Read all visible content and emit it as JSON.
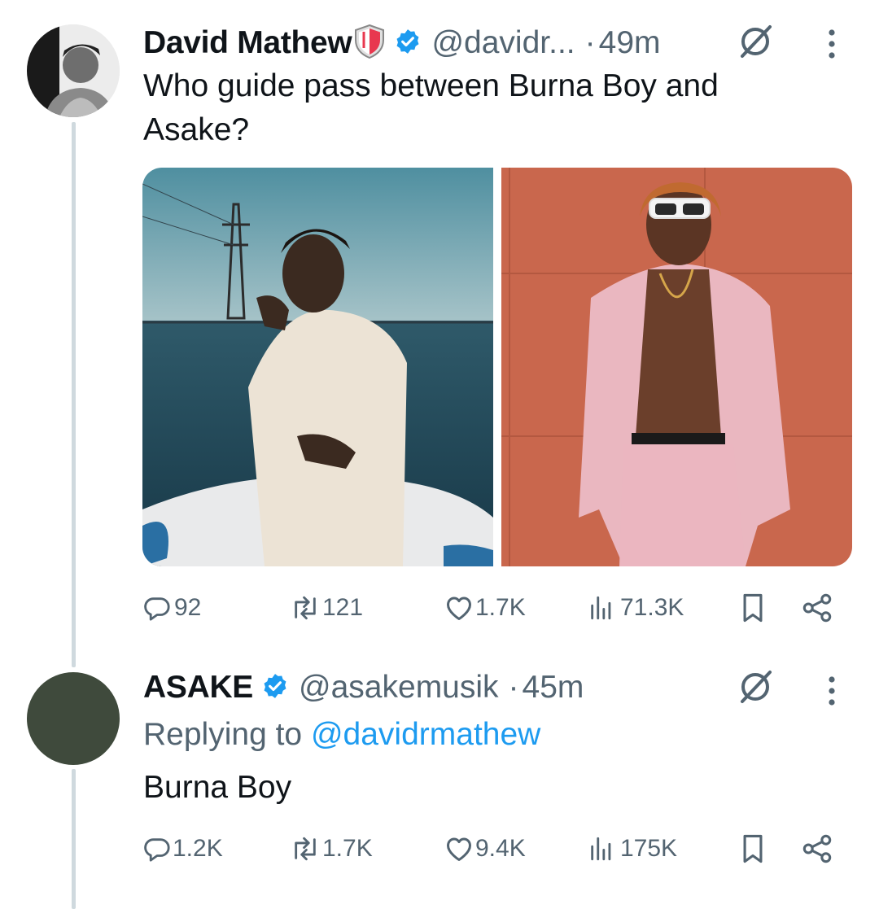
{
  "tweets": [
    {
      "author": {
        "name": "David Mathew",
        "badge_icon": "shield-icon",
        "verified_icon": "verified-badge-icon",
        "handle": "@davidr...",
        "time": "49m"
      },
      "text_line1": "Who guide pass between Burna Boy and",
      "text_line2": "Asake?",
      "media": [
        "photo-burna-boy-on-boat",
        "photo-asake-pink-suit"
      ],
      "stats": {
        "replies": "92",
        "reposts": "121",
        "likes": "1.7K",
        "views": "71.3K"
      }
    },
    {
      "author": {
        "name": "ASAKE",
        "verified_icon": "verified-badge-icon",
        "handle": "@asakemusik",
        "time": "45m"
      },
      "replying_prefix": "Replying to ",
      "replying_handle": "@davidrmathew",
      "text": "Burna Boy",
      "stats": {
        "replies": "1.2K",
        "reposts": "1.7K",
        "likes": "9.4K",
        "views": "175K"
      }
    }
  ],
  "separator": "·",
  "colors": {
    "verified": "#1d9bf0",
    "link": "#1d9bf0",
    "muted": "#536471",
    "avatar_reply": "#3f4a3c"
  }
}
